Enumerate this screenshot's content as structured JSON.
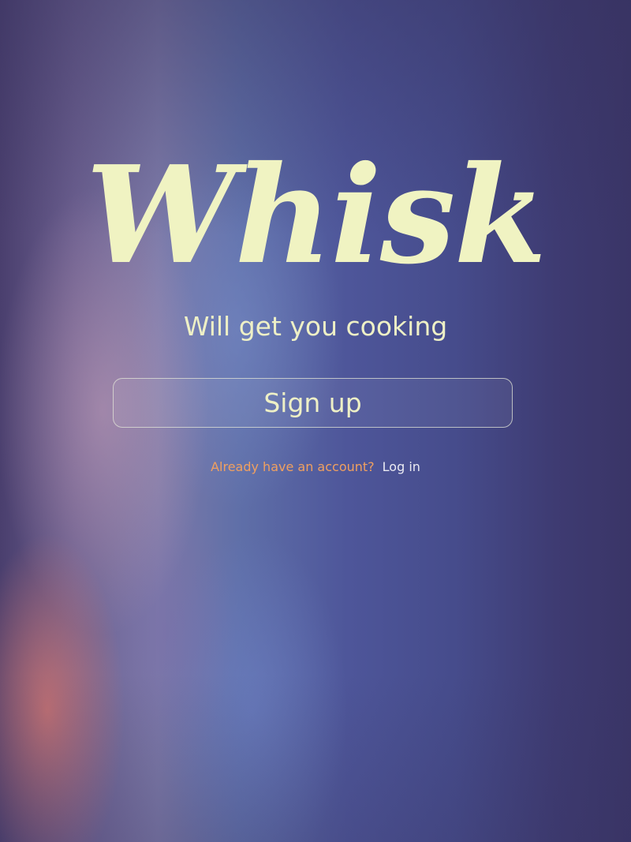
{
  "app": {
    "logo_text": "Whisk",
    "tagline": "Will get you cooking"
  },
  "actions": {
    "signup_label": "Sign up",
    "login_prompt": "Already have an account?",
    "login_label": "Log in"
  },
  "colors": {
    "logo": "#f0f3c2",
    "prompt_accent": "#f0a060",
    "link": "#eaeaf2"
  }
}
